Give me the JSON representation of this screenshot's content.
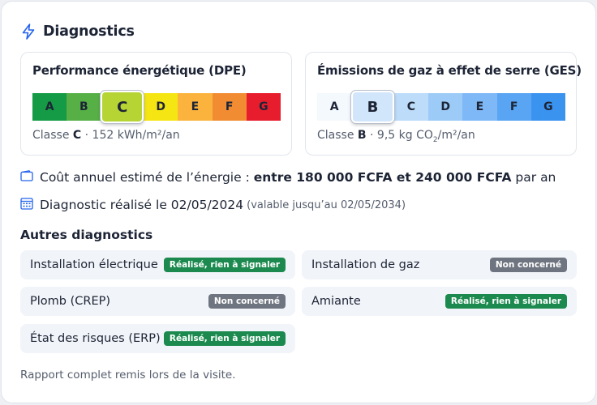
{
  "header": {
    "title": "Diagnostics",
    "icon": "lightning-icon",
    "accent": "#2563eb"
  },
  "dpe": {
    "title": "Performance énergétique (DPE)",
    "active": "C",
    "classes": [
      {
        "letter": "A",
        "color": "#159a45"
      },
      {
        "letter": "B",
        "color": "#56b045"
      },
      {
        "letter": "C",
        "color": "#b6d434"
      },
      {
        "letter": "D",
        "color": "#f5e512"
      },
      {
        "letter": "E",
        "color": "#fbb33e"
      },
      {
        "letter": "F",
        "color": "#f28c33"
      },
      {
        "letter": "G",
        "color": "#e71d2e"
      }
    ],
    "caption_prefix": "Classe ",
    "caption_class": "C",
    "caption_value": " · 152 kWh/m²/an"
  },
  "ges": {
    "title": "Émissions de gaz à effet de serre (GES)",
    "active": "B",
    "classes": [
      {
        "letter": "A",
        "color": "#f4f9fe"
      },
      {
        "letter": "B",
        "color": "#d2e6fb"
      },
      {
        "letter": "C",
        "color": "#bcdcfa"
      },
      {
        "letter": "D",
        "color": "#9ccbf7"
      },
      {
        "letter": "E",
        "color": "#7fb8f6"
      },
      {
        "letter": "F",
        "color": "#5aa5f3"
      },
      {
        "letter": "G",
        "color": "#3b93f0"
      }
    ],
    "caption_prefix": "Classe ",
    "caption_class": "B",
    "caption_value_pre": " · 9,5 kg CO",
    "caption_value_sub": "2",
    "caption_value_post": "/m²/an"
  },
  "cost": {
    "icon": "wallet-icon",
    "label": "Coût annuel estimé de l’énergie : ",
    "range": "entre 180 000 FCFA et 240 000 FCFA",
    "suffix": " par an"
  },
  "diagnostic_date": {
    "icon": "calendar-icon",
    "label": "Diagnostic réalisé le 02/05/2024",
    "validity": "(valable jusqu’au 02/05/2034)"
  },
  "others": {
    "title": "Autres diagnostics",
    "items": [
      {
        "label": "Installation électrique",
        "status": "Réalisé, rien à signaler",
        "kind": "ok"
      },
      {
        "label": "Installation de gaz",
        "status": "Non concerné",
        "kind": "na"
      },
      {
        "label": "Plomb (CREP)",
        "status": "Non concerné",
        "kind": "na"
      },
      {
        "label": "Amiante",
        "status": "Réalisé, rien à signaler",
        "kind": "ok"
      },
      {
        "label": "État des risques (ERP)",
        "status": "Réalisé, rien à signaler",
        "kind": "ok"
      }
    ]
  },
  "footer": "Rapport complet remis lors de la visite."
}
